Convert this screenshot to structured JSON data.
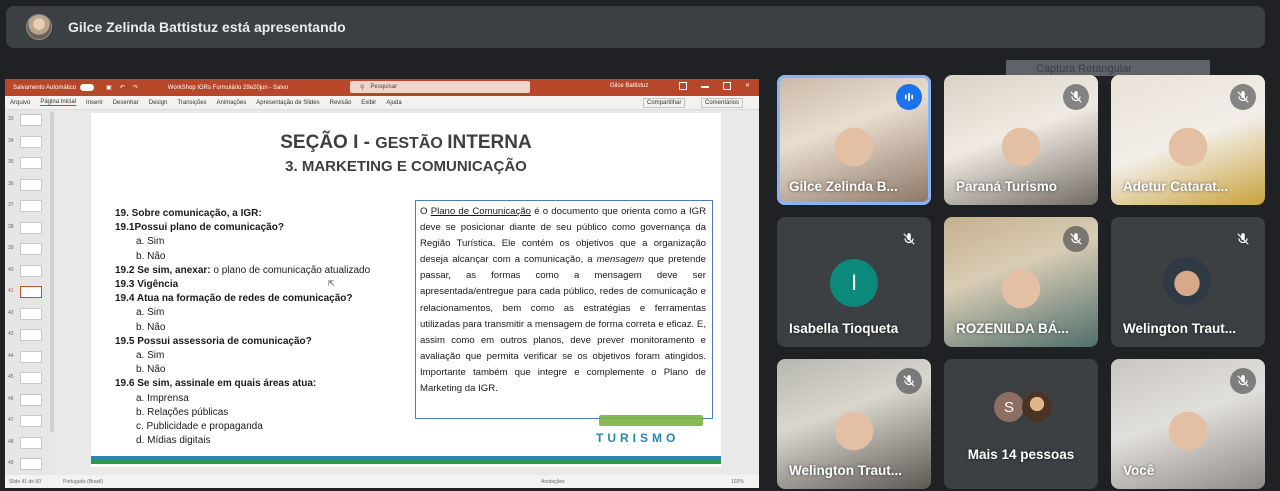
{
  "banner": {
    "presenter_text": "Gilce Zelinda Battistuz está apresentando"
  },
  "ppt": {
    "autosave": "Salvamento Automático",
    "file_title": "WorkShop IGRs Formulário 29e20jun - Salvo",
    "search_placeholder": "Pesquisar",
    "user": "Gilce Battistuz",
    "tabs": [
      "Arquivo",
      "Página Inicial",
      "Inserir",
      "Desenhar",
      "Design",
      "Transições",
      "Animações",
      "Apresentação de Slides",
      "Revisão",
      "Exibir",
      "Ajuda"
    ],
    "share": "Compartilhar",
    "comments": "Comentários",
    "thumb_numbers": [
      "33",
      "34",
      "35",
      "36",
      "37",
      "38",
      "39",
      "40",
      "41",
      "42",
      "43",
      "44",
      "45",
      "46",
      "47",
      "48",
      "49"
    ],
    "selected_slide": "41",
    "status_left": "Slide 41 de 60",
    "status_lang": "Português (Brasil)",
    "status_notes": "Anotações",
    "status_zoom": "102%"
  },
  "slide": {
    "title_1": "SEÇÃO I - ",
    "title_small": "GESTÃO ",
    "title_2": "INTERNA",
    "subtitle": "3. MARKETING E COMUNICAÇÃO",
    "questions": [
      {
        "text": "19.  Sobre comunicação, a IGR:",
        "bold": true
      },
      {
        "text": "19.1Possui plano de comunicação?",
        "bold": true
      },
      {
        "text": "a. Sim",
        "bold": false
      },
      {
        "text": "b. Não",
        "bold": false
      },
      {
        "text": "19.2  Se sim, anexar:",
        "bold": true,
        "rest": " o plano de comunicação atualizado"
      },
      {
        "text": "19.3  Vigência",
        "bold": true
      },
      {
        "text": "19.4  Atua na formação de redes de comunicação?",
        "bold": true
      },
      {
        "text": "a. Sim",
        "bold": false
      },
      {
        "text": "b. Não",
        "bold": false
      },
      {
        "text": "19.5 Possui assessoria de comunicação?",
        "bold": true
      },
      {
        "text": "a. Sim",
        "bold": false
      },
      {
        "text": "b. Não",
        "bold": false
      },
      {
        "text": "19.6  Se sim, assinale em quais áreas atua:",
        "bold": true
      },
      {
        "text": "a. Imprensa",
        "bold": false
      },
      {
        "text": "b. Relações públicas",
        "bold": false
      },
      {
        "text": "c. Publicidade e propaganda",
        "bold": false
      },
      {
        "text": "d. Mídias digitais",
        "bold": false
      }
    ],
    "info_pre": "O ",
    "info_link": "Plano de Comunicação",
    "info_mid": " é o documento que orienta como a IGR deve se posicionar diante de seu público como governança da Região Turística. Ele contém os objetivos que a organização deseja alcançar com a comunicação, a ",
    "info_italic": "mensagem",
    "info_post": " que pretende passar, as formas como a mensagem deve ser apresentada/entregue para cada público, redes de comunicação e relacionamentos, bem como as estratégias e ferramentas utilizadas para transmitir a mensagem de forma correta e eficaz. E, assim como em outros planos, deve prever monitoramento e avaliação que permita verificar se os objetivos foram atingidos. Importante também que integre e complemente o Plano de Marketing da IGR.",
    "logo_text": "TURISMO"
  },
  "overlay": {
    "label": "Captura Retangular"
  },
  "participants": [
    {
      "name": "Gilce Zelinda B...",
      "muted": false,
      "speaking": true
    },
    {
      "name": "Paraná Turismo",
      "muted": true,
      "speaking": false
    },
    {
      "name": "Adetur Catarat...",
      "muted": true,
      "speaking": false
    },
    {
      "name": "Isabella Tioqueta",
      "muted": true,
      "speaking": false,
      "initial": "I"
    },
    {
      "name": "ROZENILDA BÁ...",
      "muted": true,
      "speaking": false
    },
    {
      "name": "Welington Traut...",
      "muted": true,
      "speaking": false
    },
    {
      "name": "Welington Traut...",
      "muted": true,
      "speaking": false
    },
    {
      "name": "Mais 14 pessoas",
      "muted": false,
      "speaking": false,
      "initial": "S"
    },
    {
      "name": "Você",
      "muted": true,
      "speaking": false
    }
  ],
  "colors": {
    "accent": "#8ab4f8",
    "ppt_brand": "#b7472a",
    "tile_bg": "#3c4043"
  }
}
